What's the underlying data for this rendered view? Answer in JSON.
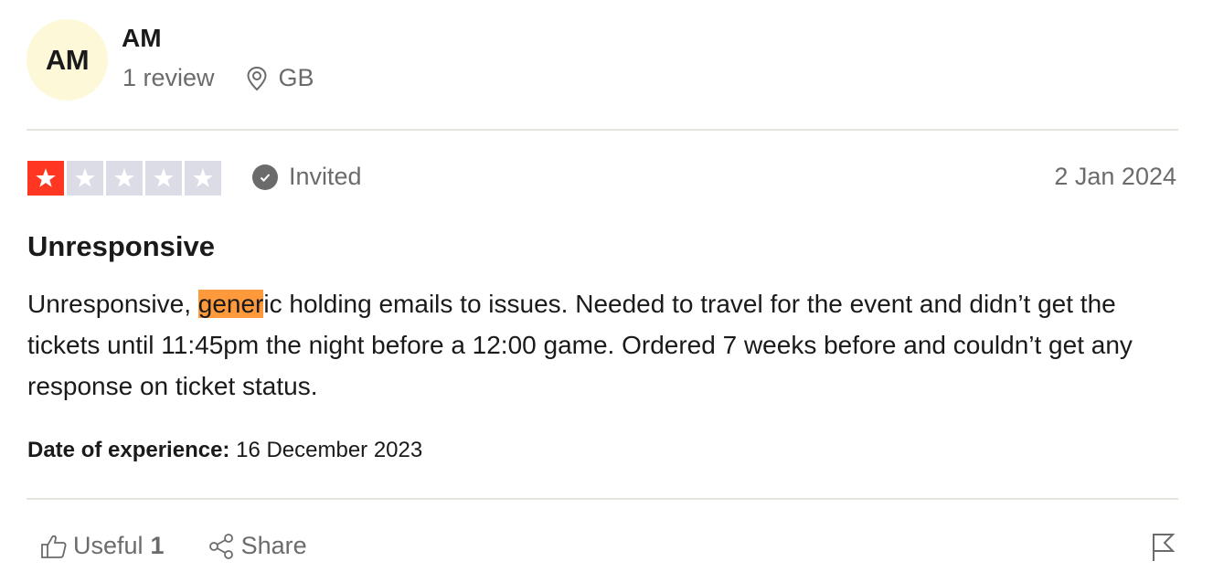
{
  "reviewer": {
    "initials": "AM",
    "name": "AM",
    "review_count": "1 review",
    "country": "GB",
    "avatar_color": "#fcf8d8"
  },
  "review": {
    "rating": 1,
    "max_rating": 5,
    "star_active_color": "#ff3722",
    "star_inactive_color": "#dcdce6",
    "status_label": "Invited",
    "date": "2 Jan 2024",
    "title": "Unresponsive",
    "body_before_highlight": "Unresponsive, ",
    "body_highlight": "gener",
    "body_after_highlight": "ic holding emails to issues. Needed to travel for the event and didn’t get the tickets until 11:45pm the night before a 12:00 game. Ordered 7 weeks before and couldn’t get any response on ticket status.",
    "highlight_color": "#ff9a3c",
    "date_of_experience_label": "Date of experience:",
    "date_of_experience": "16 December 2023"
  },
  "actions": {
    "useful_label": "Useful",
    "useful_count": "1",
    "share_label": "Share",
    "icons": [
      "thumbs-up-icon",
      "share-icon",
      "flag-icon"
    ]
  }
}
